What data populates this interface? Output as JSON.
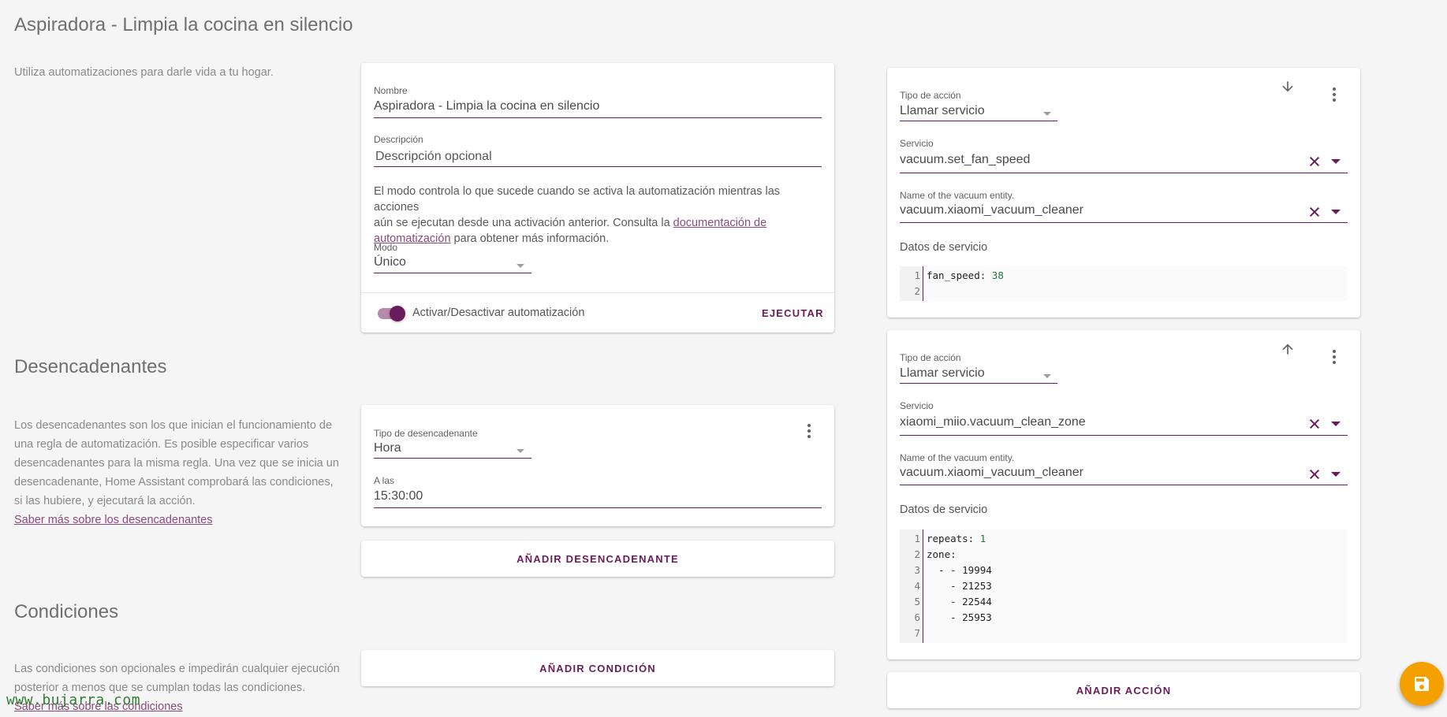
{
  "page": {
    "title": "Aspiradora - Limpia la cocina en silencio",
    "intro": "Utiliza automatizaciones para darle vida a tu hogar."
  },
  "automation_card": {
    "name_label": "Nombre",
    "name_value": "Aspiradora - Limpia la cocina en silencio",
    "description_label": "Descripción",
    "description_placeholder": "Descripción opcional",
    "mode_text_1": "El modo controla lo que sucede cuando se activa la automatización mientras las acciones",
    "mode_text_2a": "aún se ejecutan desde una activación anterior. Consulta la ",
    "mode_link_1": "documentación de",
    "mode_link_2": "automatización",
    "mode_text_3": " para obtener más información.",
    "mode_label": "Modo",
    "mode_value": "Único",
    "toggle_label": "Activar/Desactivar automatización",
    "toggle_on": true,
    "run_label": "EJECUTAR"
  },
  "triggers": {
    "title": "Desencadenantes",
    "description": [
      "Los desencadenantes son los que inician el funcionamiento de",
      "una regla de automatización. Es posible especificar varios",
      "desencadenantes para la misma regla. Una vez que se inicia un",
      "desencadenante, Home Assistant comprobará las condiciones,",
      "si las hubiere, y ejecutará la acción."
    ],
    "learn_more": "Saber más sobre los desencadenantes",
    "type_label": "Tipo de desencadenante",
    "type_value": "Hora",
    "at_label": "A las",
    "at_value": "15:30:00",
    "add_button": "AÑADIR DESENCADENANTE"
  },
  "conditions": {
    "title": "Condiciones",
    "description": [
      "Las condiciones son opcionales e impedirán cualquier ejecución",
      "posterior a menos que se cumplan todas las condiciones."
    ],
    "learn_more": "Saber más sobre las condiciones",
    "add_button": "AÑADIR CONDICIÓN"
  },
  "actions": {
    "items": [
      {
        "type_label": "Tipo de acción",
        "type_value": "Llamar servicio",
        "service_label": "Servicio",
        "service_value": "vacuum.set_fan_speed",
        "entity_label": "Name of the vacuum entity.",
        "entity_value": "vacuum.xiaomi_vacuum_cleaner",
        "data_label": "Datos de servicio",
        "code": [
          {
            "n": "1",
            "k": "fan_speed:",
            "v": " 38"
          },
          {
            "n": "2",
            "k": "",
            "v": ""
          }
        ]
      },
      {
        "type_label": "Tipo de acción",
        "type_value": "Llamar servicio",
        "service_label": "Servicio",
        "service_value": "xiaomi_miio.vacuum_clean_zone",
        "entity_label": "Name of the vacuum entity.",
        "entity_value": "vacuum.xiaomi_vacuum_cleaner",
        "data_label": "Datos de servicio",
        "code": [
          {
            "n": "1",
            "k": "repeats:",
            "v": " 1"
          },
          {
            "n": "2",
            "k": "zone:",
            "v": ""
          },
          {
            "n": "3",
            "k": "  - - 19994",
            "v": ""
          },
          {
            "n": "4",
            "k": "    - 21253",
            "v": ""
          },
          {
            "n": "5",
            "k": "    - 22544",
            "v": ""
          },
          {
            "n": "6",
            "k": "    - 25953",
            "v": ""
          },
          {
            "n": "7",
            "k": "",
            "v": ""
          }
        ]
      }
    ],
    "add_button": "AÑADIR ACCIÓN"
  },
  "icons": {
    "move_down": "arrow-down-icon",
    "move_up": "arrow-up-icon",
    "menu": "dots-vertical-icon",
    "clear": "close-icon",
    "save": "floppy-icon"
  },
  "colors": {
    "primary": "#6a1b5a",
    "accent_fab": "#f4a100",
    "background": "#f5f5f5"
  },
  "watermark": "www.bujarra.com"
}
